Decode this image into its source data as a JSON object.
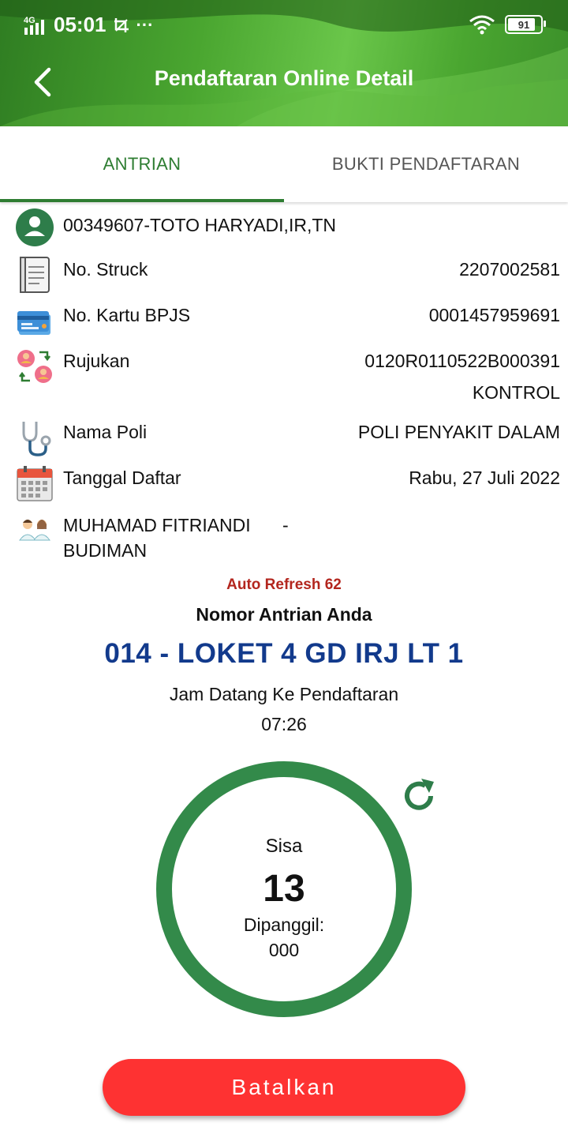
{
  "status_bar": {
    "network": "4G",
    "time": "05:01",
    "more": "···",
    "battery": "91",
    "icons": [
      "signal-icon",
      "wifi-icon",
      "battery-icon"
    ]
  },
  "header": {
    "title": "Pendaftaran Online Detail",
    "back_icon": "arrow-back-icon"
  },
  "tabs": [
    {
      "label": "ANTRIAN",
      "active": true
    },
    {
      "label": "BUKTI PENDAFTARAN",
      "active": false
    }
  ],
  "patient": {
    "name": "00349607-TOTO HARYADI,IR,TN",
    "icon": "person-icon"
  },
  "details": [
    {
      "label": "No. Struck",
      "value": "2207002581",
      "icon": "receipt-icon"
    },
    {
      "label": "No. Kartu BPJS",
      "value": "0001457959691",
      "icon": "card-icon"
    },
    {
      "label": "Rujukan",
      "value": "0120R0110522B000391",
      "value2": "KONTROL",
      "icon": "referral-icon"
    },
    {
      "label": "Nama Poli",
      "value": "POLI PENYAKIT DALAM",
      "icon": "stethoscope-icon"
    },
    {
      "label": "Tanggal Daftar",
      "value": "Rabu, 27 Juli 2022",
      "icon": "calendar-icon"
    }
  ],
  "doctor": {
    "name_line1": "MUHAMAD FITRIANDI",
    "name_line2": "BUDIMAN",
    "value": "-",
    "icon": "doctors-icon"
  },
  "queue": {
    "auto_refresh": "Auto Refresh 62",
    "nomor_label": "Nomor Antrian Anda",
    "nomor": "014 - LOKET 4 GD IRJ LT 1",
    "jam_label": "Jam Datang Ke Pendaftaran",
    "jam": "07:26",
    "sisa_label": "Sisa",
    "sisa": "13",
    "dipanggil_label": "Dipanggil:",
    "dipanggil": "000",
    "refresh_icon": "refresh-icon"
  },
  "colors": {
    "accent": "#2e7d32",
    "ring": "#338a4a",
    "queue_number": "#123a8c",
    "auto_refresh": "#b3261e",
    "cancel_button": "#fe3232"
  },
  "actions": {
    "cancel_label": "Batalkan"
  }
}
